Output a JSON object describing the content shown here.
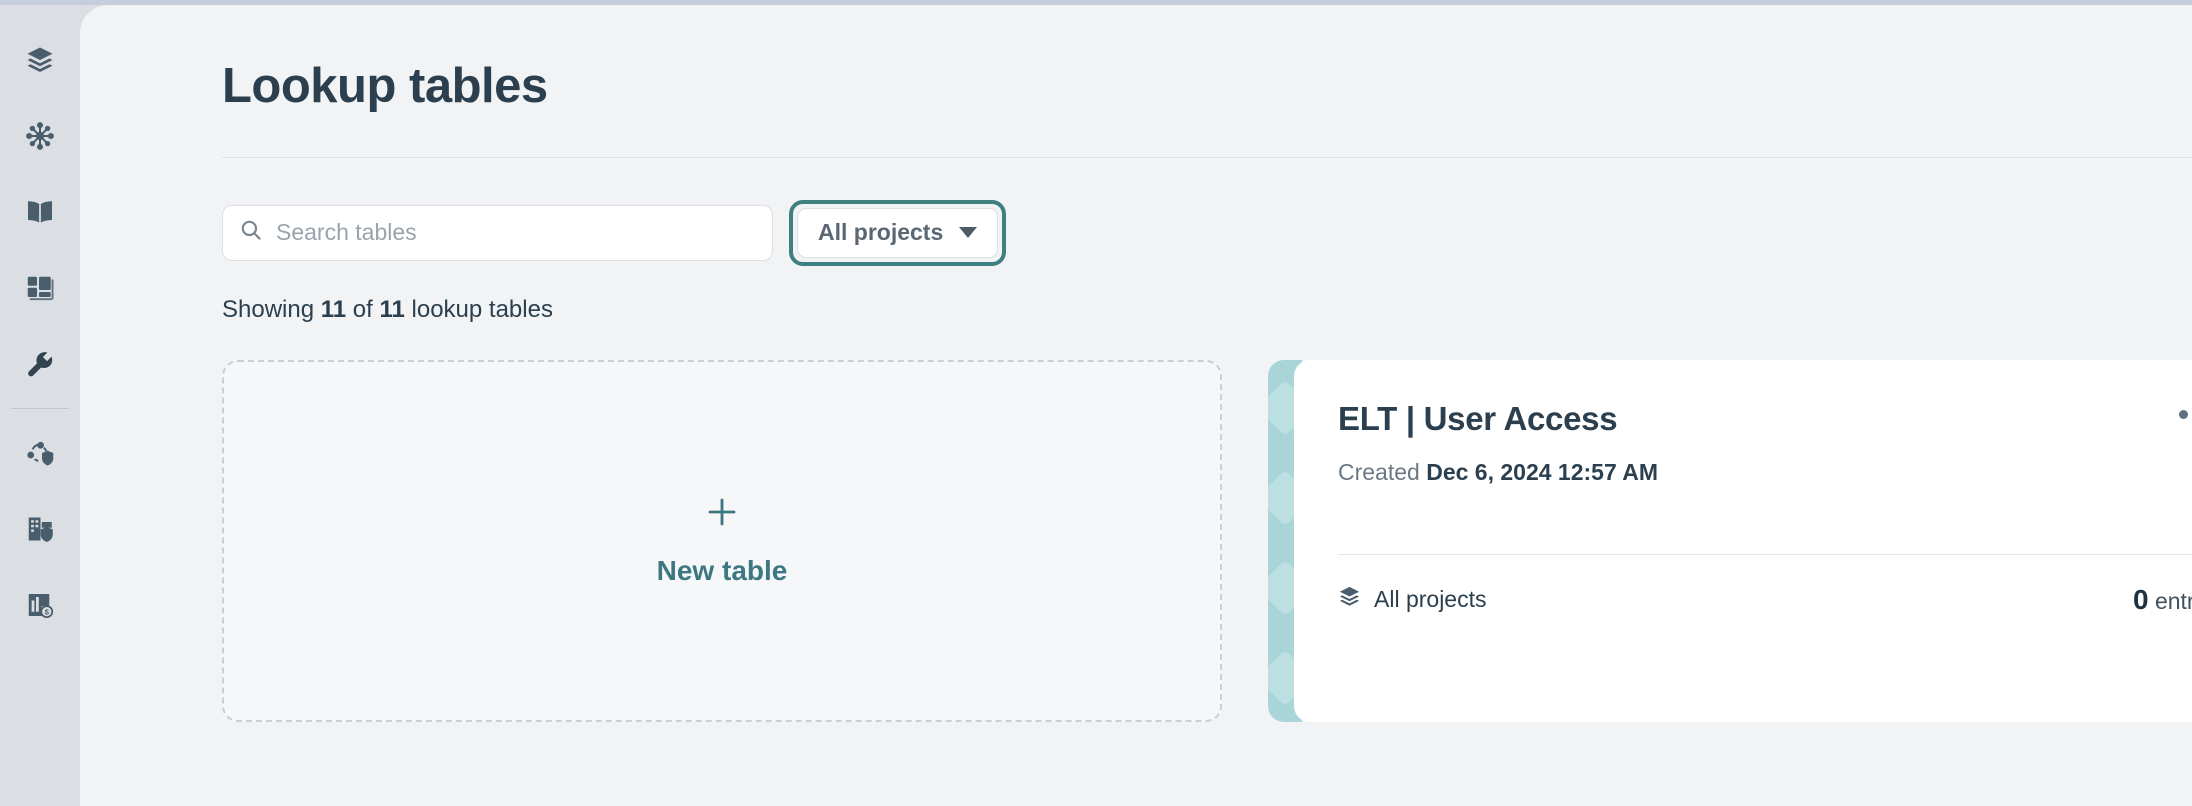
{
  "theme": {
    "accent_teal": "#3f7f80",
    "title_color": "#2b3f4e",
    "card_stripe": "#a9d5d9",
    "panel_bg": "#f2f3f5",
    "sidebar_bg": "#dbdfe3",
    "top_strip": "#c6cddd"
  },
  "sidebar": {
    "items": [
      {
        "icon": "layers-icon",
        "name": "sidebar-item-layers"
      },
      {
        "icon": "network-hub-icon",
        "name": "sidebar-item-network"
      },
      {
        "icon": "book-icon",
        "name": "sidebar-item-catalog"
      },
      {
        "icon": "dashboard-icon",
        "name": "sidebar-item-dashboard"
      },
      {
        "icon": "wrench-icon",
        "name": "sidebar-item-tools"
      },
      {
        "icon": "network-shield-icon",
        "name": "sidebar-item-network-security"
      },
      {
        "icon": "building-shield-icon",
        "name": "sidebar-item-org-security"
      },
      {
        "icon": "report-dollar-icon",
        "name": "sidebar-item-billing"
      }
    ]
  },
  "header": {
    "title": "Lookup tables"
  },
  "search": {
    "placeholder": "Search tables",
    "value": "",
    "icon": "search-icon"
  },
  "project_filter": {
    "label": "All projects",
    "icon": "chevron-down-icon",
    "focused": true
  },
  "summary": {
    "prefix": "Showing",
    "shown": "11",
    "middle": "of",
    "total": "11",
    "suffix": "lookup tables"
  },
  "new_table_card": {
    "icon": "plus-icon",
    "label": "New table"
  },
  "tables": [
    {
      "title": "ELT | User Access",
      "created_prefix": "Created",
      "created_value": "Dec 6, 2024 12:57 AM",
      "scope_icon": "layers-icon",
      "scope_label": "All projects",
      "entries_count": "0",
      "entries_label": "entries",
      "menu_icon": "more-options-icon"
    }
  ]
}
